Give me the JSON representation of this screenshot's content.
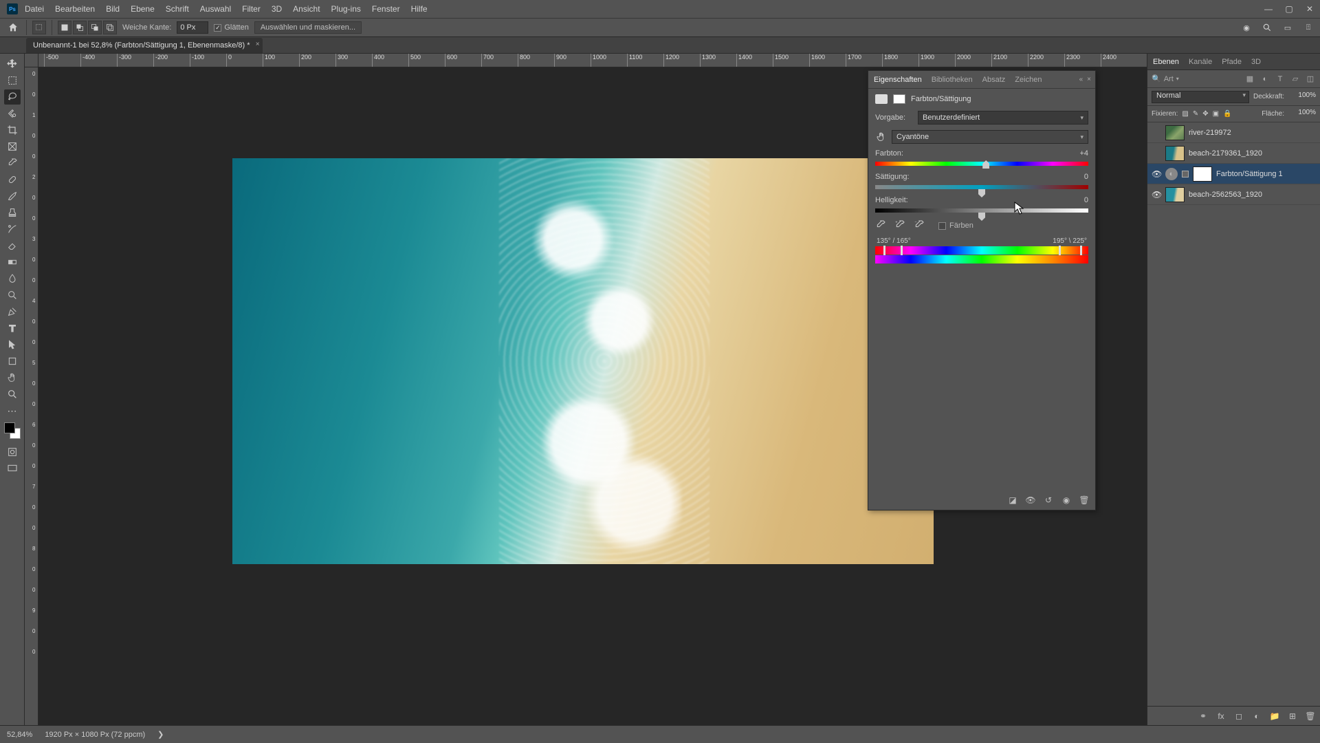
{
  "app": {
    "logo": "Ps"
  },
  "menu": {
    "items": [
      "Datei",
      "Bearbeiten",
      "Bild",
      "Ebene",
      "Schrift",
      "Auswahl",
      "Filter",
      "3D",
      "Ansicht",
      "Plug-ins",
      "Fenster",
      "Hilfe"
    ]
  },
  "options": {
    "feather_label": "Weiche Kante:",
    "feather_value": "0 Px",
    "antialias_label": "Glätten",
    "select_mask_label": "Auswählen und maskieren..."
  },
  "document": {
    "tab_title": "Unbenannt-1 bei 52,8% (Farbton/Sättigung 1, Ebenenmaske/8) *"
  },
  "ruler_h": [
    "-500",
    "-400",
    "-300",
    "-200",
    "-100",
    "0",
    "100",
    "200",
    "300",
    "400",
    "500",
    "600",
    "700",
    "800",
    "900",
    "1000",
    "1100",
    "1200",
    "1300",
    "1400",
    "1500",
    "1600",
    "1700",
    "1800",
    "1900",
    "2000",
    "2100",
    "2200",
    "2300",
    "2400"
  ],
  "ruler_v": [
    "0",
    "0",
    "1",
    "0",
    "0",
    "2",
    "0",
    "0",
    "3",
    "0",
    "0",
    "4",
    "0",
    "0",
    "5",
    "0",
    "0",
    "6",
    "0",
    "0",
    "7",
    "0",
    "0",
    "8",
    "0",
    "0",
    "9",
    "0",
    "0"
  ],
  "properties": {
    "tabs": [
      "Eigenschaften",
      "Bibliotheken",
      "Absatz",
      "Zeichen"
    ],
    "adjustment_title": "Farbton/Sättigung",
    "preset_label": "Vorgabe:",
    "preset_value": "Benutzerdefiniert",
    "channel_value": "Cyantöne",
    "hue_label": "Farbton:",
    "hue_value": "+4",
    "sat_label": "Sättigung:",
    "sat_value": "0",
    "light_label": "Helligkeit:",
    "light_value": "0",
    "colorize_label": "Färben",
    "range_left": "135° / 165°",
    "range_right": "195° \\ 225°"
  },
  "layers_panel": {
    "tabs": [
      "Ebenen",
      "Kanäle",
      "Pfade",
      "3D"
    ],
    "filter_label": "Art",
    "blend_mode": "Normal",
    "opacity_label": "Deckkraft:",
    "opacity_value": "100%",
    "lock_label": "Fixieren:",
    "fill_label": "Fläche:",
    "fill_value": "100%",
    "layers": [
      {
        "name": "river-219972",
        "visible": false,
        "type": "image",
        "thumb": "river"
      },
      {
        "name": "beach-2179361_1920",
        "visible": false,
        "type": "image",
        "thumb": "beach1"
      },
      {
        "name": "Farbton/Sättigung 1",
        "visible": true,
        "type": "adjustment",
        "selected": true
      },
      {
        "name": "beach-2562563_1920",
        "visible": true,
        "type": "image",
        "thumb": "beach2"
      }
    ]
  },
  "status": {
    "zoom": "52,84%",
    "doc_info": "1920 Px × 1080 Px (72 ppcm)"
  }
}
